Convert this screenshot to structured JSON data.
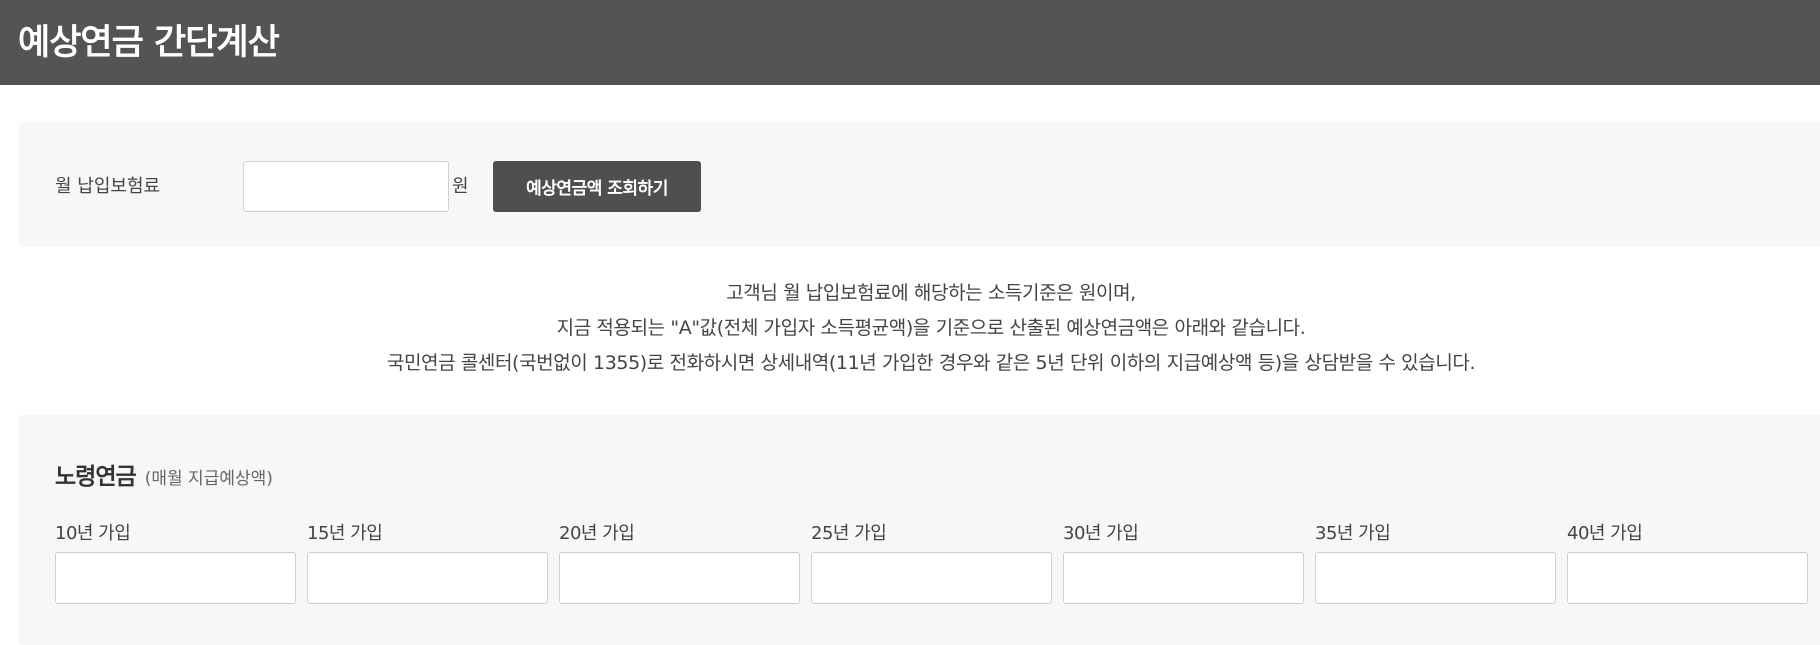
{
  "header": {
    "title": "예상연금 간단계산"
  },
  "input_panel": {
    "label": "월 납입보험료",
    "premium_value": "",
    "unit": "원",
    "button_label": "예상연금액 조회하기"
  },
  "info": {
    "lines": [
      "고객님 월 납입보험료에 해당하는 소득기준은 원이며,",
      "지금 적용되는 \"A\"값(전체 가입자 소득평균액)을 기준으로 산출된 예상연금액은 아래와 같습니다.",
      "국민연금 콜센터(국번없이 1355)로 전화하시면 상세내역(11년 가입한 경우와 같은 5년 단위 이하의 지급예상액 등)을 상담받을 수 있습니다."
    ]
  },
  "pension": {
    "title": "노령연금",
    "subtitle": "(매월 지급예상액)",
    "periods": [
      {
        "label": "10년 가입",
        "value": ""
      },
      {
        "label": "15년 가입",
        "value": ""
      },
      {
        "label": "20년 가입",
        "value": ""
      },
      {
        "label": "25년 가입",
        "value": ""
      },
      {
        "label": "30년 가입",
        "value": ""
      },
      {
        "label": "35년 가입",
        "value": ""
      },
      {
        "label": "40년 가입",
        "value": ""
      }
    ]
  }
}
